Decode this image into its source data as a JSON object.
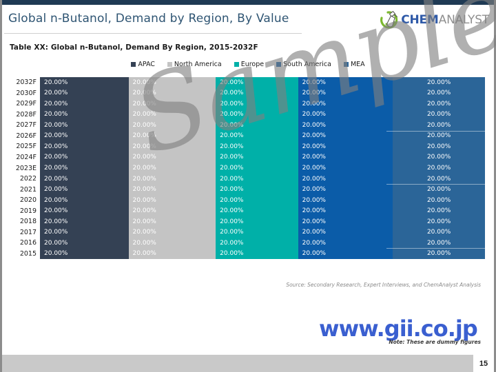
{
  "slide": {
    "title": "Global n-Butanol, Demand by Region, By Value",
    "page_number": "15",
    "table_caption": "Table XX: Global  n-Butanol, Demand By Region, 2015-2032F",
    "source_note": "Source: Secondary Research, Expert Interviews, and ChemAnalyst Analysis",
    "dummy_note": "Note: These are dummy figures",
    "site_url": "www.gii.co.jp",
    "watermark": "Sample"
  },
  "logo": {
    "mark_icon": "flask-swoosh-icon",
    "text_primary": "CHEM",
    "text_secondary": "ANALYST"
  },
  "colors": {
    "apac": "#344154",
    "north_america": "#c4c4c4",
    "europe": "#00b0a8",
    "south_america": "#0b5ca8",
    "mea": "#2b6598",
    "title": "#2f5573",
    "topbar": "#1f3a54",
    "footer": "#c9c9c9",
    "url": "#3a5fd0"
  },
  "chart_data": {
    "type": "bar",
    "title": "Table XX: Global  n-Butanol, Demand By Region, 2015-2032F",
    "orientation": "horizontal-stacked-100",
    "xlabel": "",
    "ylabel": "",
    "xlim": [
      0,
      100
    ],
    "grid": false,
    "legend_position": "top-center",
    "value_format": "20.00%",
    "categories": [
      "2032F",
      "2030F",
      "2029F",
      "2028F",
      "2027F",
      "2026F",
      "2025F",
      "2024F",
      "2023E",
      "2022",
      "2021",
      "2020",
      "2019",
      "2018",
      "2017",
      "2016",
      "2015"
    ],
    "series": [
      {
        "name": "APAC",
        "color": "#344154",
        "values": [
          20.0,
          20.0,
          20.0,
          20.0,
          20.0,
          20.0,
          20.0,
          20.0,
          20.0,
          20.0,
          20.0,
          20.0,
          20.0,
          20.0,
          20.0,
          20.0,
          20.0
        ],
        "labels": [
          "20.00%",
          "20.00%",
          "20.00%",
          "20.00%",
          "20.00%",
          "20.00%",
          "20.00%",
          "20.00%",
          "20.00%",
          "20.00%",
          "20.00%",
          "20.00%",
          "20.00%",
          "20.00%",
          "20.00%",
          "20.00%",
          "20.00%"
        ]
      },
      {
        "name": "North America",
        "color": "#c4c4c4",
        "values": [
          20.0,
          20.0,
          20.0,
          20.0,
          20.0,
          20.0,
          20.0,
          20.0,
          20.0,
          20.0,
          20.0,
          20.0,
          20.0,
          20.0,
          20.0,
          20.0,
          20.0
        ],
        "labels": [
          "20.00%",
          "20.00%",
          "20.00%",
          "20.00%",
          "20.00%",
          "20.00%",
          "20.00%",
          "20.00%",
          "20.00%",
          "20.00%",
          "20.00%",
          "20.00%",
          "20.00%",
          "20.00%",
          "20.00%",
          "20.00%",
          "20.00%"
        ]
      },
      {
        "name": "Europe",
        "color": "#00b0a8",
        "values": [
          20.0,
          20.0,
          20.0,
          20.0,
          20.0,
          20.0,
          20.0,
          20.0,
          20.0,
          20.0,
          20.0,
          20.0,
          20.0,
          20.0,
          20.0,
          20.0,
          20.0
        ],
        "labels": [
          "20.00%",
          "20.00%",
          "20.00%",
          "20.00%",
          "20.00%",
          "20.00%",
          "20.00%",
          "20.00%",
          "20.00%",
          "20.00%",
          "20.00%",
          "20.00%",
          "20.00%",
          "20.00%",
          "20.00%",
          "20.00%",
          "20.00%"
        ]
      },
      {
        "name": "South America",
        "color": "#0b5ca8",
        "values": [
          20.0,
          20.0,
          20.0,
          20.0,
          20.0,
          20.0,
          20.0,
          20.0,
          20.0,
          20.0,
          20.0,
          20.0,
          20.0,
          20.0,
          20.0,
          20.0,
          20.0
        ],
        "labels": [
          "20.00%",
          "20.00%",
          "20.00%",
          "20.00%",
          "20.00%",
          "20.00%",
          "20.00%",
          "20.00%",
          "20.00%",
          "20.00%",
          "20.00%",
          "20.00%",
          "20.00%",
          "20.00%",
          "20.00%",
          "20.00%",
          "20.00%"
        ]
      },
      {
        "name": "MEA",
        "color": "#2b6598",
        "values": [
          20.0,
          20.0,
          20.0,
          20.0,
          20.0,
          20.0,
          20.0,
          20.0,
          20.0,
          20.0,
          20.0,
          20.0,
          20.0,
          20.0,
          20.0,
          20.0,
          20.0
        ],
        "labels": [
          "20.00%",
          "20.00%",
          "20.00%",
          "20.00%",
          "20.00%",
          "20.00%",
          "20.00%",
          "20.00%",
          "20.00%",
          "20.00%",
          "20.00%",
          "20.00%",
          "20.00%",
          "20.00%",
          "20.00%",
          "20.00%",
          "20.00%"
        ]
      }
    ]
  }
}
